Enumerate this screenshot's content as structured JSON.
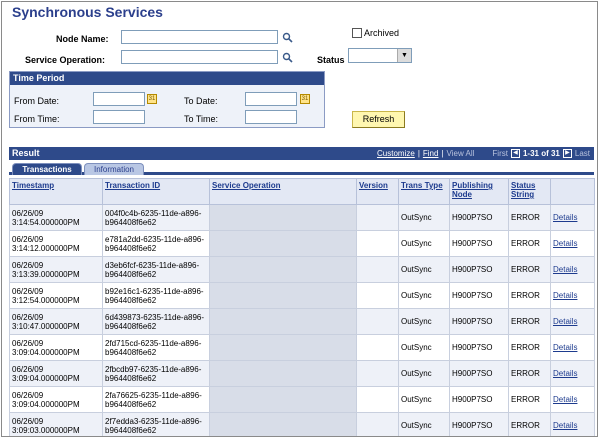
{
  "page": {
    "title": "Synchronous Services"
  },
  "search": {
    "node_name_label": "Node Name:",
    "node_name_value": "",
    "service_operation_label": "Service Operation:",
    "service_operation_value": "",
    "archived_label": "Archived",
    "archived_checked": false,
    "status_label": "Status",
    "status_value": ""
  },
  "time_period": {
    "title": "Time Period",
    "from_date_label": "From Date:",
    "to_date_label": "To Date:",
    "from_time_label": "From Time:",
    "to_time_label": "To Time:",
    "from_date_value": "",
    "to_date_value": "",
    "from_time_value": "",
    "to_time_value": ""
  },
  "refresh_label": "Refresh",
  "result": {
    "title": "Result",
    "customize": "Customize",
    "find": "Find",
    "view_all": "View All",
    "first": "First",
    "range": "1-31 of 31",
    "last": "Last",
    "prev_icon": "left-arrow-icon",
    "next_icon": "right-arrow-icon"
  },
  "tabs": [
    {
      "label": "Transactions",
      "active": true
    },
    {
      "label": "Information",
      "active": false
    }
  ],
  "table": {
    "headers": [
      "Timestamp",
      "Transaction ID",
      "Service Operation",
      "Version",
      "Trans Type",
      "Publishing Node",
      "Status String",
      ""
    ],
    "rows": [
      {
        "timestamp": "06/26/09 3:14:54.000000PM",
        "txn": "004f0c4b-6235-11de-a896-b964408f6e62",
        "service": "",
        "version": "",
        "type": "OutSync",
        "node": "H900P7SO",
        "status": "ERROR",
        "details": "Details"
      },
      {
        "timestamp": "06/26/09 3:14:12.000000PM",
        "txn": "e781a2dd-6235-11de-a896-b964408f6e62",
        "service": "",
        "version": "",
        "type": "OutSync",
        "node": "H900P7SO",
        "status": "ERROR",
        "details": "Details"
      },
      {
        "timestamp": "06/26/09 3:13:39.000000PM",
        "txn": "d3eb6fcf-6235-11de-a896-b964408f6e62",
        "service": "",
        "version": "",
        "type": "OutSync",
        "node": "H900P7SO",
        "status": "ERROR",
        "details": "Details"
      },
      {
        "timestamp": "06/26/09 3:12:54.000000PM",
        "txn": "b92e16c1-6235-11de-a896-b964408f6e62",
        "service": "",
        "version": "",
        "type": "OutSync",
        "node": "H900P7SO",
        "status": "ERROR",
        "details": "Details"
      },
      {
        "timestamp": "06/26/09 3:10:47.000000PM",
        "txn": "6d439873-6235-11de-a896-b964408f6e62",
        "service": "",
        "version": "",
        "type": "OutSync",
        "node": "H900P7SO",
        "status": "ERROR",
        "details": "Details"
      },
      {
        "timestamp": "06/26/09 3:09:04.000000PM",
        "txn": "2fd715cd-6235-11de-a896-b964408f6e62",
        "service": "",
        "version": "",
        "type": "OutSync",
        "node": "H900P7SO",
        "status": "ERROR",
        "details": "Details"
      },
      {
        "timestamp": "06/26/09 3:09:04.000000PM",
        "txn": "2fbcdb97-6235-11de-a896-b964408f6e62",
        "service": "",
        "version": "",
        "type": "OutSync",
        "node": "H900P7SO",
        "status": "ERROR",
        "details": "Details"
      },
      {
        "timestamp": "06/26/09 3:09:04.000000PM",
        "txn": "2fa76625-6235-11de-a896-b964408f6e62",
        "service": "",
        "version": "",
        "type": "OutSync",
        "node": "H900P7SO",
        "status": "ERROR",
        "details": "Details"
      },
      {
        "timestamp": "06/26/09 3:09:03.000000PM",
        "txn": "2f7edda3-6235-11de-a896-b964408f6e62",
        "service": "",
        "version": "",
        "type": "OutSync",
        "node": "H900P7SO",
        "status": "ERROR",
        "details": "Details"
      }
    ]
  },
  "colors": {
    "title_blue": "#2b3f8c",
    "header_bar": "#2e4a8a",
    "refresh_bg": "#fff7b0",
    "row_alt": "#eef1f8"
  },
  "icons": {
    "lookup": "magnifier-lookup-icon",
    "calendar": "calendar-icon",
    "dropdown": "chevron-down-icon"
  }
}
